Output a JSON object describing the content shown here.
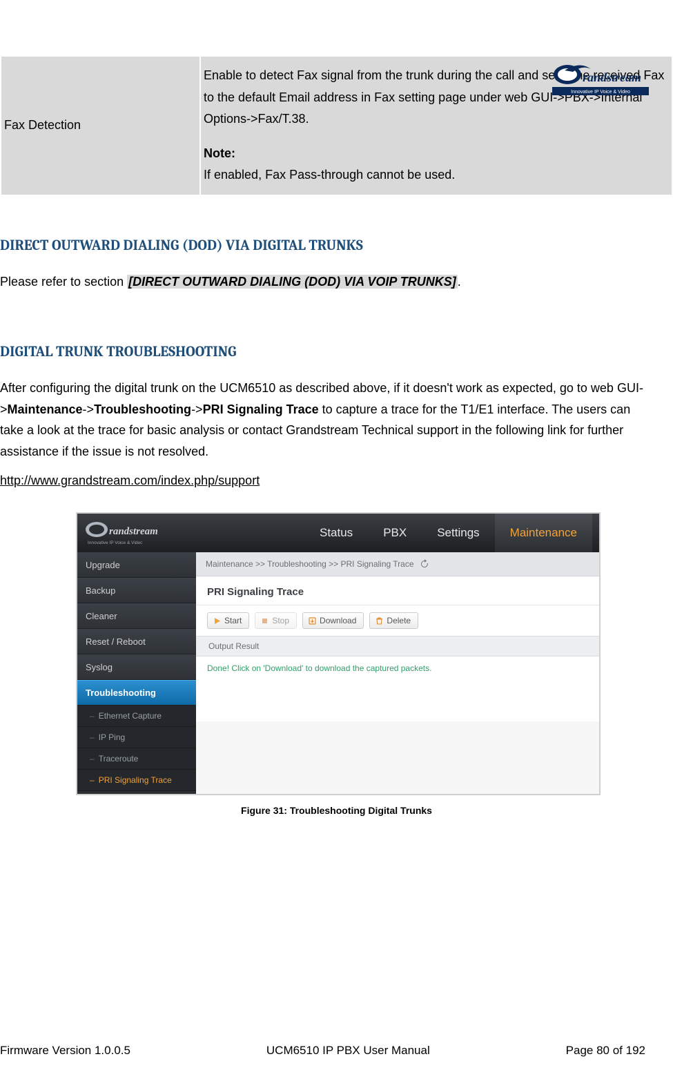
{
  "header": {
    "logo_tagline": "Innovative IP Voice & Video"
  },
  "table": {
    "row1": {
      "label": "Fax Detection",
      "desc_line1": "Enable to detect Fax signal from the trunk during the call and send the received Fax to the default Email address in Fax setting page under web GUI->PBX->Internal Options->Fax/T.38.",
      "note_label": "Note:",
      "note_text": "If enabled, Fax Pass-through cannot be used."
    }
  },
  "section1": {
    "heading": "DIRECT OUTWARD DIALING (DOD) VIA DIGITAL TRUNKS",
    "body_prefix": "Please refer to section ",
    "body_ref": "[DIRECT OUTWARD DIALING (DOD) VIA VOIP TRUNKS]",
    "body_suffix": "."
  },
  "section2": {
    "heading": "DIGITAL TRUNK TROUBLESHOOTING",
    "body_prefix": "After configuring the digital trunk on the UCM6510 as described above, if it doesn't work as expected, go to web GUI->",
    "bold1": "Maintenance",
    "sep": "->",
    "bold2": "Troubleshooting",
    "bold3": "PRI Signaling Trace",
    "body_suffix": " to capture a trace for the T1/E1 interface. The users can take a look at the trace for basic analysis or contact Grandstream Technical support in the following link for further assistance if the issue is not resolved.",
    "link": "http://www.grandstream.com/index.php/support"
  },
  "ui": {
    "logo_tagline": "Innovative IP Voice & Videc",
    "nav": [
      "Status",
      "PBX",
      "Settings",
      "Maintenance"
    ],
    "nav_active_index": 3,
    "breadcrumb": "Maintenance >> Troubleshooting >> PRI Signaling Trace",
    "panel_title": "PRI Signaling Trace",
    "buttons": {
      "start": "Start",
      "stop": "Stop",
      "download": "Download",
      "delete": "Delete"
    },
    "output_header": "Output Result",
    "output_text": "Done! Click on 'Download' to download the captured packets.",
    "sidebar": [
      "Upgrade",
      "Backup",
      "Cleaner",
      "Reset / Reboot",
      "Syslog",
      "Troubleshooting"
    ],
    "sidebar_active_index": 5,
    "sidebar_sub": [
      "Ethernet Capture",
      "IP Ping",
      "Traceroute",
      "PRI Signaling Trace"
    ],
    "sidebar_sub_active_index": 3
  },
  "figure_caption": "Figure 31: Troubleshooting Digital Trunks",
  "footer": {
    "left": "Firmware Version 1.0.0.5",
    "center": "UCM6510 IP PBX User Manual",
    "right": "Page 80 of 192"
  }
}
